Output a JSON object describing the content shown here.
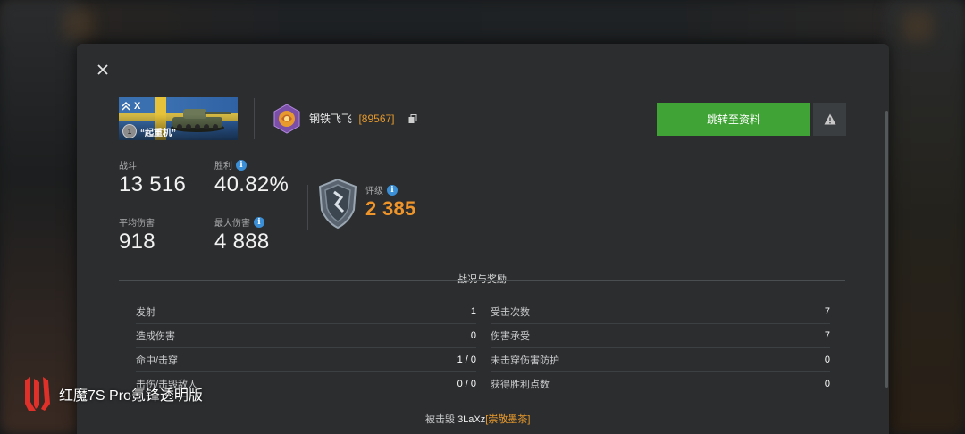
{
  "tank": {
    "tier": "X",
    "mastery_level": "1",
    "name": "“起重机”"
  },
  "player": {
    "name": "钢铁飞飞",
    "clan_tag": "[89567]"
  },
  "buttons": {
    "profile_label": "跳转至资料"
  },
  "stats": {
    "battles": {
      "label": "战斗",
      "value": "13 516"
    },
    "winrate": {
      "label": "胜利",
      "value": "40.82%"
    },
    "avg_damage": {
      "label": "平均伤害",
      "value": "918"
    },
    "max_damage": {
      "label": "最大伤害",
      "value": "4 888"
    },
    "rating": {
      "label": "评级",
      "value": "2 385"
    }
  },
  "section_title": "战况与奖励",
  "battle_stats_left": [
    {
      "label": "发射",
      "value": "1"
    },
    {
      "label": "造成伤害",
      "value": "0"
    },
    {
      "label": "命中/击穿",
      "value": "1 / 0"
    },
    {
      "label": "击伤/击毁敌人",
      "value": "0 / 0"
    }
  ],
  "battle_stats_right": [
    {
      "label": "受击次数",
      "value": "7"
    },
    {
      "label": "伤害承受",
      "value": "7"
    },
    {
      "label": "未击穿伤害防护",
      "value": "0"
    },
    {
      "label": "获得胜利点数",
      "value": "0"
    }
  ],
  "destroyed_by": {
    "prefix": "被击毁",
    "name": "3LaXz",
    "clan_tag": "[崇敬墨茶]"
  },
  "watermark": {
    "text": "红魔7S Pro氪锋透明版"
  },
  "colors": {
    "accent_green": "#3fa335",
    "accent_orange": "#f0952a",
    "info_blue": "#3a8fd6",
    "panel_bg": "#2b2d2f"
  }
}
